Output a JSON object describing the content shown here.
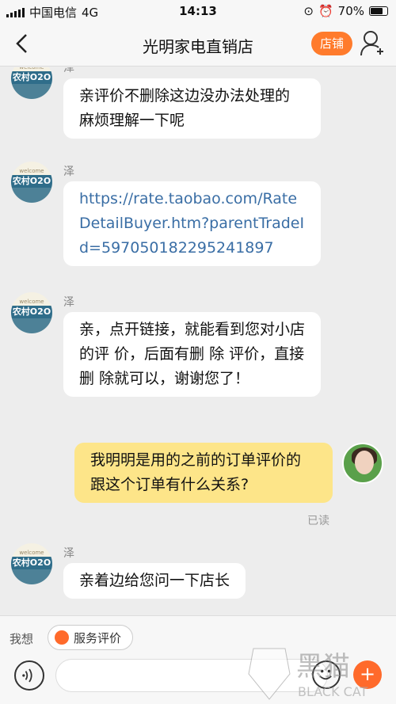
{
  "status_bar": {
    "carrier": "中国电信",
    "network": "4G",
    "time": "14:13",
    "battery": "70%"
  },
  "header": {
    "title": "光明家电直销店",
    "shop_button": "店铺"
  },
  "seller": {
    "avatar_top": "welcome",
    "avatar_text": "农村O2O"
  },
  "messages": [
    {
      "sender": "泽",
      "text": "亲评价不删除这边没办法处理的 麻烦理解一下呢"
    },
    {
      "sender": "泽",
      "link": "https://rate.taobao.com/RateDetailBuyer.htm?parentTradeId=597050182295241897"
    },
    {
      "sender": "泽",
      "text": "亲，点开链接，就能看到您对小店的评 价，后面有删 除 评价，直接删 除就可以，谢谢您了！"
    },
    {
      "sender": "me",
      "text": "我明明是用的之前的订单评价的 跟这个订单有什么关系?",
      "status": "已读"
    },
    {
      "sender": "泽",
      "text": "亲着边给您问一下店长"
    }
  ],
  "bottom": {
    "label": "我想",
    "chip": "服务评价"
  },
  "watermark": {
    "cn": "黑猫",
    "en": "BLACK CAT"
  },
  "colors": {
    "accent": "#ff7b2c",
    "link": "#3a6ea5",
    "my_bubble": "#fde589"
  }
}
